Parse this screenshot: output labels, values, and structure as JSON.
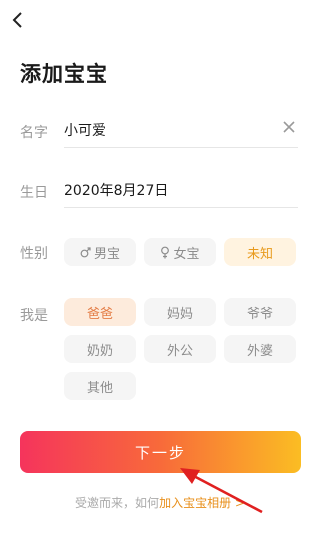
{
  "header": {
    "title": "添加宝宝"
  },
  "name": {
    "label": "名字",
    "value": "小可爱"
  },
  "birthday": {
    "label": "生日",
    "value": "2020年8月27日"
  },
  "gender": {
    "label": "性别",
    "options": [
      "男宝",
      "女宝",
      "未知"
    ],
    "selected": "未知"
  },
  "role": {
    "label": "我是",
    "options": [
      "爸爸",
      "妈妈",
      "爷爷",
      "奶奶",
      "外公",
      "外婆",
      "其他"
    ],
    "selected": "爸爸"
  },
  "next_button": {
    "label": "下一步"
  },
  "footer": {
    "text": "受邀而来，如何",
    "link": "加入宝宝相册 >"
  },
  "colors": {
    "accent": "#e89a1c",
    "gradient_start": "#f5345c",
    "gradient_end": "#fbbd23",
    "annotation_arrow": "#e02020"
  }
}
